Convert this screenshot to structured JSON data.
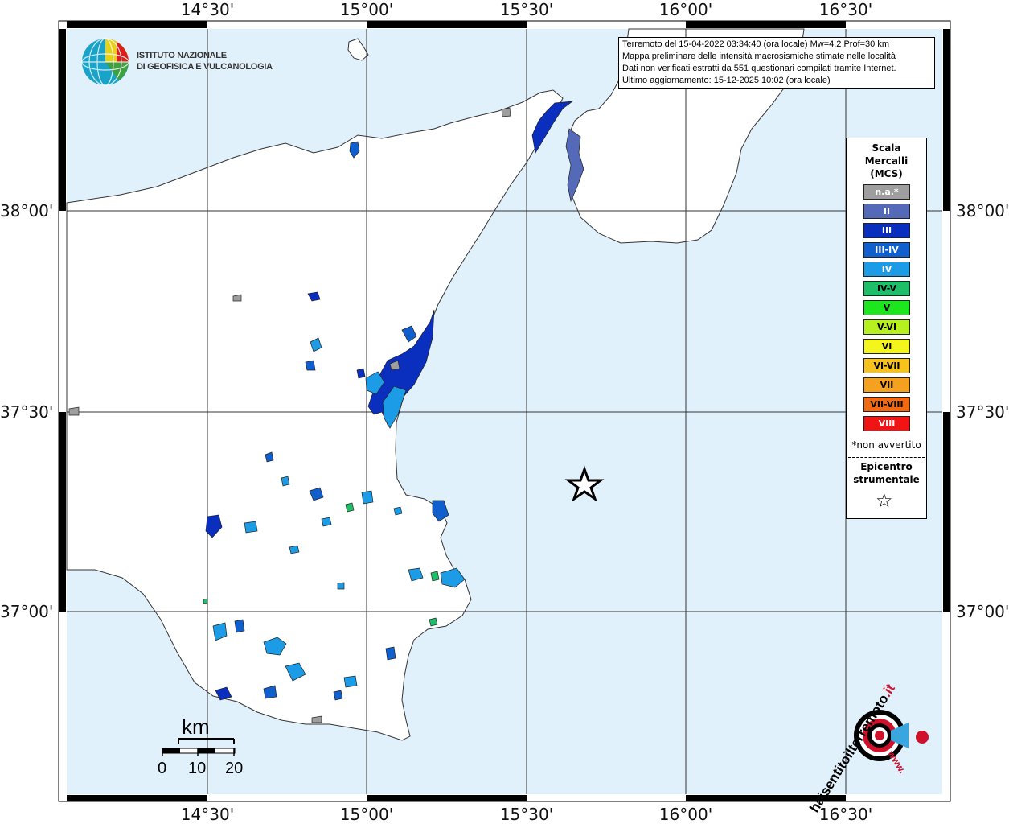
{
  "header": {
    "event_line": "Terremoto del 15-04-2022 03:34:40 (ora locale) Mw=4.2 Prof=30 km",
    "map_line": "Mappa preliminare delle intensità macrosismiche stimate nelle località",
    "data_line": "Dati non verificati estratti da 551 questionari compilati tramite Internet.",
    "update_line": "Ultimo aggiornamento: 15-12-2025 10:02 (ora locale)"
  },
  "logo": {
    "line1": "ISTITUTO NAZIONALE",
    "line2": "DI GEOFISICA E VULCANOLOGIA"
  },
  "axes": {
    "longitude_labels": [
      "14°30'",
      "15°00'",
      "15°30'",
      "16°00'",
      "16°30'"
    ],
    "latitude_labels": [
      "38°00'",
      "37°30'",
      "37°00'"
    ]
  },
  "legend": {
    "title": "Scala Mercalli (MCS)",
    "title_line1": "Scala",
    "title_line2": "Mercalli",
    "title_line3": "(MCS)",
    "items": [
      {
        "label": "n.a.*",
        "color": "#9e9e9e",
        "text_color": "#ffffff"
      },
      {
        "label": "II",
        "color": "#5469b8",
        "text_color": "#ffffff"
      },
      {
        "label": "III",
        "color": "#0a2fbf",
        "text_color": "#ffffff"
      },
      {
        "label": "III-IV",
        "color": "#0f5fcf",
        "text_color": "#ffffff"
      },
      {
        "label": "IV",
        "color": "#1c9ce6",
        "text_color": "#ffffff"
      },
      {
        "label": "IV-V",
        "color": "#1fbf6a",
        "text_color": "#000000"
      },
      {
        "label": "V",
        "color": "#1ee61e",
        "text_color": "#000000"
      },
      {
        "label": "V-VI",
        "color": "#b6f01e",
        "text_color": "#000000"
      },
      {
        "label": "VI",
        "color": "#f5f51e",
        "text_color": "#000000"
      },
      {
        "label": "VI-VII",
        "color": "#f5c21e",
        "text_color": "#000000"
      },
      {
        "label": "VII",
        "color": "#f5a01e",
        "text_color": "#000000"
      },
      {
        "label": "VII-VIII",
        "color": "#f06a14",
        "text_color": "#000000"
      },
      {
        "label": "VIII",
        "color": "#f01414",
        "text_color": "#ffffff"
      }
    ],
    "note": "*non avvertito",
    "epicenter_line1": "Epicentro",
    "epicenter_line2": "strumentale",
    "epicenter_symbol": "☆"
  },
  "scale_bar": {
    "unit": "km",
    "ticks": [
      "0",
      "10",
      "20"
    ]
  },
  "watermark": {
    "text_main": "haisentitoilterremoto",
    "text_suffix": ".it",
    "text_www": "www."
  },
  "colors": {
    "sea": "#e1f1fc",
    "land": "#ffffff",
    "grid": "#333333"
  }
}
